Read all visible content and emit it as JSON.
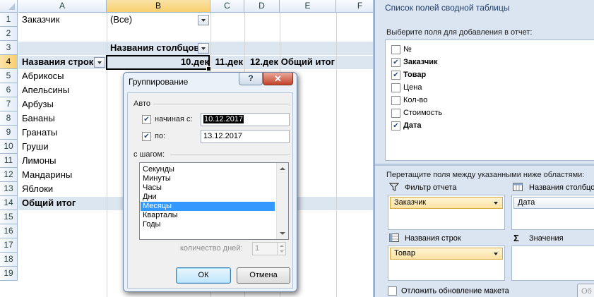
{
  "sheet": {
    "columns": [
      "A",
      "B",
      "C",
      "D",
      "E",
      "F"
    ],
    "rows": [
      "1",
      "2",
      "3",
      "4",
      "5",
      "6",
      "7",
      "8",
      "9",
      "10",
      "11",
      "12",
      "13",
      "14",
      "15",
      "16",
      "17",
      "18",
      "19"
    ],
    "filter_label": "Заказчик",
    "filter_value": "(Все)",
    "col_labels_header": "Названия столбцов",
    "row_labels_header": "Названия строк",
    "col_values": [
      "10.дек",
      "11.дек",
      "12.дек"
    ],
    "grand_total_col": "Общий итог",
    "row_items": [
      "Абрикосы",
      "Апельсины",
      "Арбузы",
      "Бананы",
      "Гранаты",
      "Груши",
      "Лимоны",
      "Мандарины",
      "Яблоки"
    ],
    "grand_total_row": "Общий итог"
  },
  "dialog": {
    "title": "Группирование",
    "help": "?",
    "close": "✕",
    "auto_group": "Авто",
    "start_label": "начиная с:",
    "start_value": "10.12.2017",
    "end_label": "по:",
    "end_value": "13.12.2017",
    "step_group": "с шагом:",
    "step_options": [
      "Секунды",
      "Минуты",
      "Часы",
      "Дни",
      "Месяцы",
      "Кварталы",
      "Годы"
    ],
    "selected_step": "Месяцы",
    "days_label": "количество дней:",
    "days_value": "1",
    "ok": "ОК",
    "cancel": "Отмена"
  },
  "pane": {
    "title": "Список полей сводной таблицы",
    "choose_fields": "Выберите поля для добавления в отчет:",
    "fields": [
      {
        "name": "№",
        "checked": false
      },
      {
        "name": "Заказчик",
        "checked": true
      },
      {
        "name": "Товар",
        "checked": true
      },
      {
        "name": "Цена",
        "checked": false
      },
      {
        "name": "Кол-во",
        "checked": false
      },
      {
        "name": "Стоимость",
        "checked": false
      },
      {
        "name": "Дата",
        "checked": true
      }
    ],
    "drag_hint": "Перетащите поля между указанными ниже областями:",
    "report_filter": "Фильтр отчета",
    "column_labels": "Названия столбцо",
    "row_labels": "Названия строк",
    "values": "Значения",
    "filter_chip": "Заказчик",
    "column_chip": "Дата",
    "row_chip": "Товар",
    "defer_update": "Отложить обновление макета",
    "update_button": "Об"
  }
}
